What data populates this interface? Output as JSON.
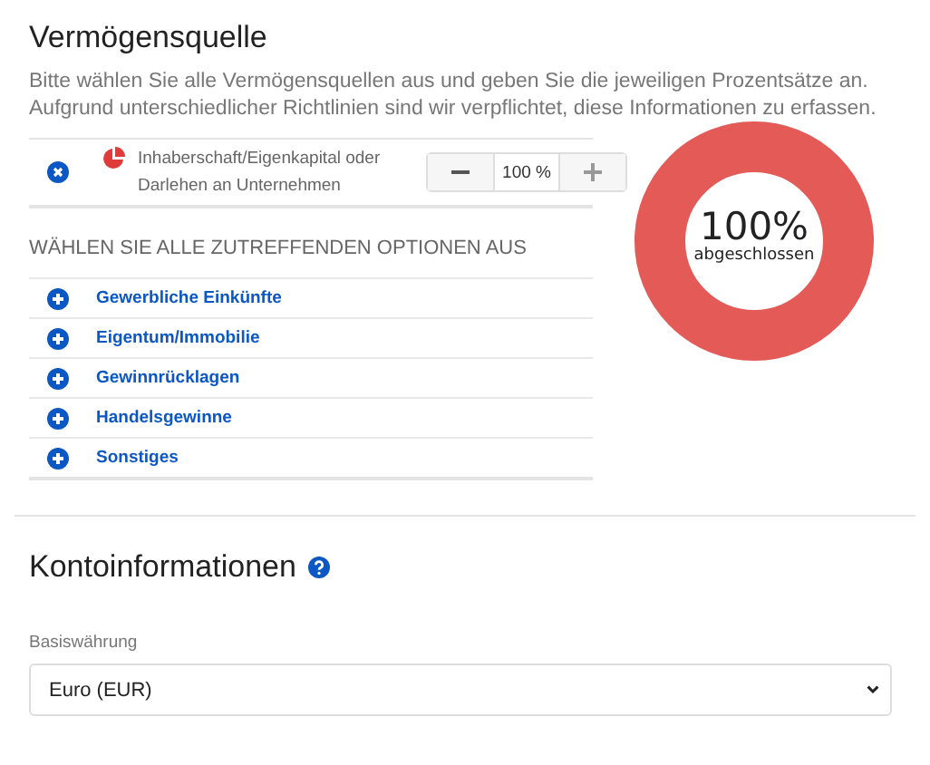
{
  "wealth_source": {
    "title": "Vermögensquelle",
    "description": "Bitte wählen Sie alle Vermögensquellen aus und geben Sie die jeweiligen Prozentsätze an. Aufgrund unterschiedlicher Richtlinien sind wir verpflichtet, diese Informationen zu erfassen.",
    "selected_sources": [
      {
        "label": "Inhaberschaft/Eigenkapital oder Darlehen an Unternehmen",
        "value": "100 %"
      }
    ],
    "options_heading": "WÄHLEN SIE ALLE ZUTREFFENDEN OPTIONEN AUS",
    "options": [
      "Gewerbliche Einkünfte",
      "Eigentum/Immobilie",
      "Gewinnrücklagen",
      "Handelsgewinne",
      "Sonstiges"
    ],
    "progress": {
      "level": 1,
      "percent": "100%",
      "caption": "abgeschlossen"
    }
  },
  "account_info": {
    "title": "Kontoinformationen",
    "currency_label": "Basiswährung",
    "currency": "Euro (EUR)"
  }
}
